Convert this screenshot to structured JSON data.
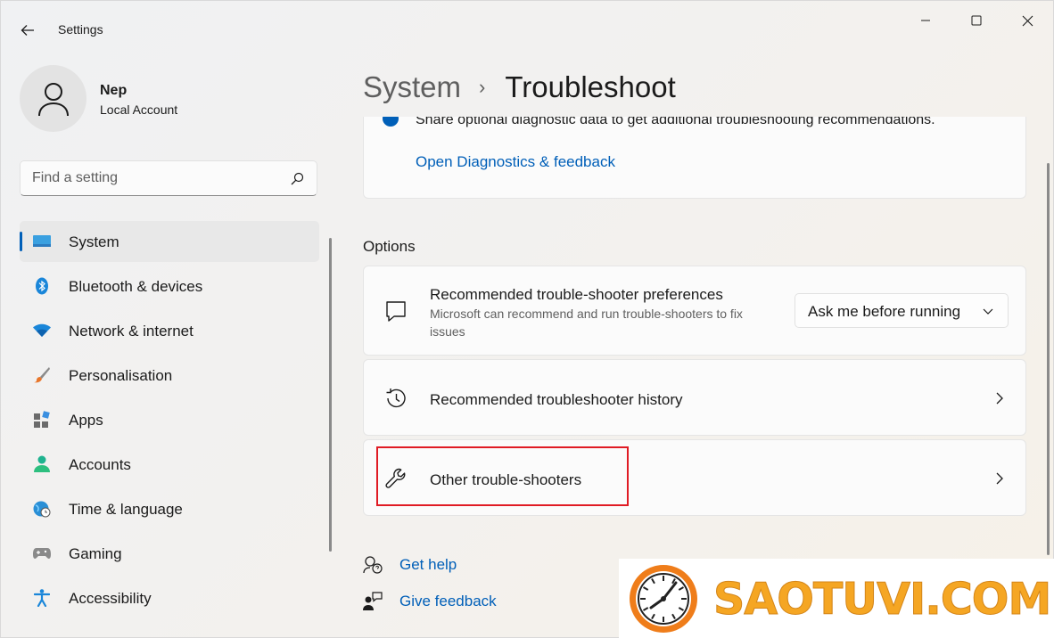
{
  "window": {
    "app_title": "Settings",
    "controls": [
      "minimize",
      "maximize",
      "close"
    ]
  },
  "profile": {
    "name": "Nep",
    "account_type": "Local Account"
  },
  "search": {
    "placeholder": "Find a setting"
  },
  "sidebar": {
    "items": [
      {
        "label": "System",
        "icon": "system-icon",
        "active": true
      },
      {
        "label": "Bluetooth & devices",
        "icon": "bluetooth-icon"
      },
      {
        "label": "Network & internet",
        "icon": "wifi-icon"
      },
      {
        "label": "Personalisation",
        "icon": "brush-icon"
      },
      {
        "label": "Apps",
        "icon": "apps-icon"
      },
      {
        "label": "Accounts",
        "icon": "person-icon"
      },
      {
        "label": "Time & language",
        "icon": "globe-clock-icon"
      },
      {
        "label": "Gaming",
        "icon": "gamepad-icon"
      },
      {
        "label": "Accessibility",
        "icon": "accessibility-icon"
      }
    ]
  },
  "breadcrumb": {
    "parent": "System",
    "separator": "›",
    "current": "Troubleshoot"
  },
  "diagnostics": {
    "text": "Share optional diagnostic data to get additional troubleshooting recommendations.",
    "link": "Open Diagnostics & feedback"
  },
  "options": {
    "heading": "Options",
    "cards": [
      {
        "title": "Recommended trouble-shooter preferences",
        "description": "Microsoft can recommend and run trouble-shooters to fix issues",
        "icon": "chat-bubble-icon",
        "dropdown_value": "Ask me before running"
      },
      {
        "title": "Recommended troubleshooter history",
        "icon": "history-icon"
      },
      {
        "title": "Other trouble-shooters",
        "icon": "wrench-icon",
        "highlighted": true
      }
    ]
  },
  "help_links": {
    "get_help": "Get help",
    "give_feedback": "Give feedback"
  },
  "watermark": {
    "text": "SAOTUVI.COM"
  },
  "colors": {
    "accent": "#005fb8",
    "highlight_border": "#e01b24",
    "watermark_orange": "#f5a623"
  }
}
